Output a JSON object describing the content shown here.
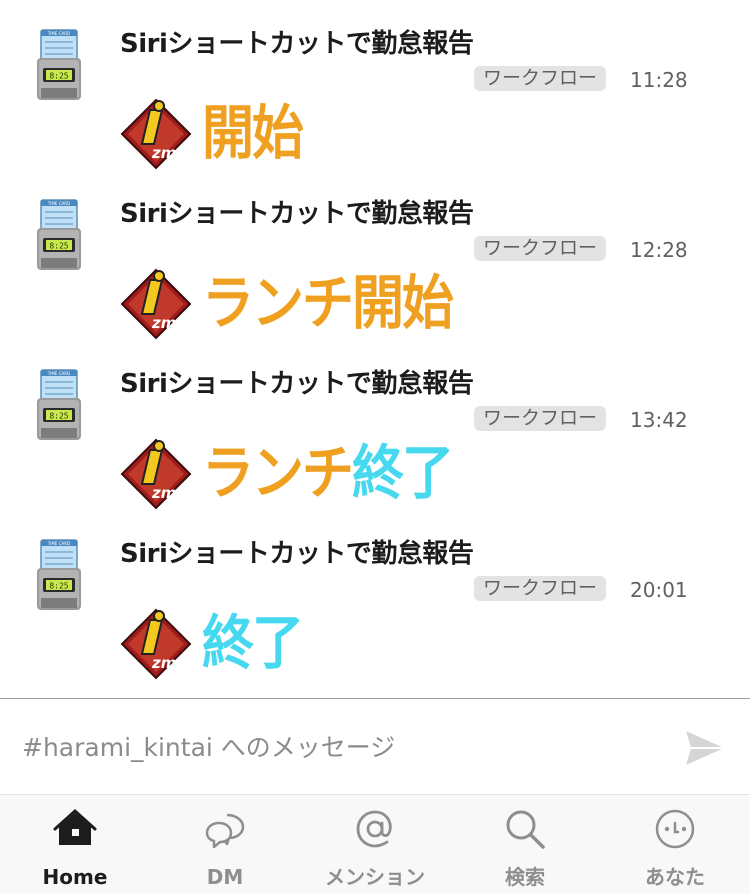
{
  "messages": [
    {
      "sender": "Siriショートカットで勤怠報告",
      "badge": "ワークフロー",
      "time": "11:28",
      "status_parts": [
        {
          "text": "開始",
          "color": "#f0a020"
        }
      ]
    },
    {
      "sender": "Siriショートカットで勤怠報告",
      "badge": "ワークフロー",
      "time": "12:28",
      "status_parts": [
        {
          "text": "ランチ",
          "color": "#f0a020"
        },
        {
          "text": "開始",
          "color": "#f0a020"
        }
      ]
    },
    {
      "sender": "Siriショートカットで勤怠報告",
      "badge": "ワークフロー",
      "time": "13:42",
      "status_parts": [
        {
          "text": "ランチ",
          "color": "#f0a020"
        },
        {
          "text": "終了",
          "color": "#45d8ee"
        }
      ]
    },
    {
      "sender": "Siriショートカットで勤怠報告",
      "badge": "ワークフロー",
      "time": "20:01",
      "status_parts": [
        {
          "text": "終了",
          "color": "#45d8ee"
        }
      ]
    }
  ],
  "stamp_logo_text": "zm",
  "avatar_clock_text": "8:25",
  "avatar_card_text": "TIME CARD",
  "composer": {
    "placeholder": "#harami_kintai へのメッセージ",
    "value": ""
  },
  "tabs": [
    {
      "label": "Home",
      "icon": "home-icon",
      "active": true
    },
    {
      "label": "DM",
      "icon": "dm-icon",
      "active": false
    },
    {
      "label": "メンション",
      "icon": "mention-icon",
      "active": false
    },
    {
      "label": "検索",
      "icon": "search-icon",
      "active": false
    },
    {
      "label": "あなた",
      "icon": "you-icon",
      "active": false
    }
  ],
  "colors": {
    "accent_orange": "#f0a020",
    "accent_cyan": "#45d8ee",
    "badge_bg": "#e3e3e3",
    "text_primary": "#1d1c1d",
    "text_muted": "#616061"
  }
}
